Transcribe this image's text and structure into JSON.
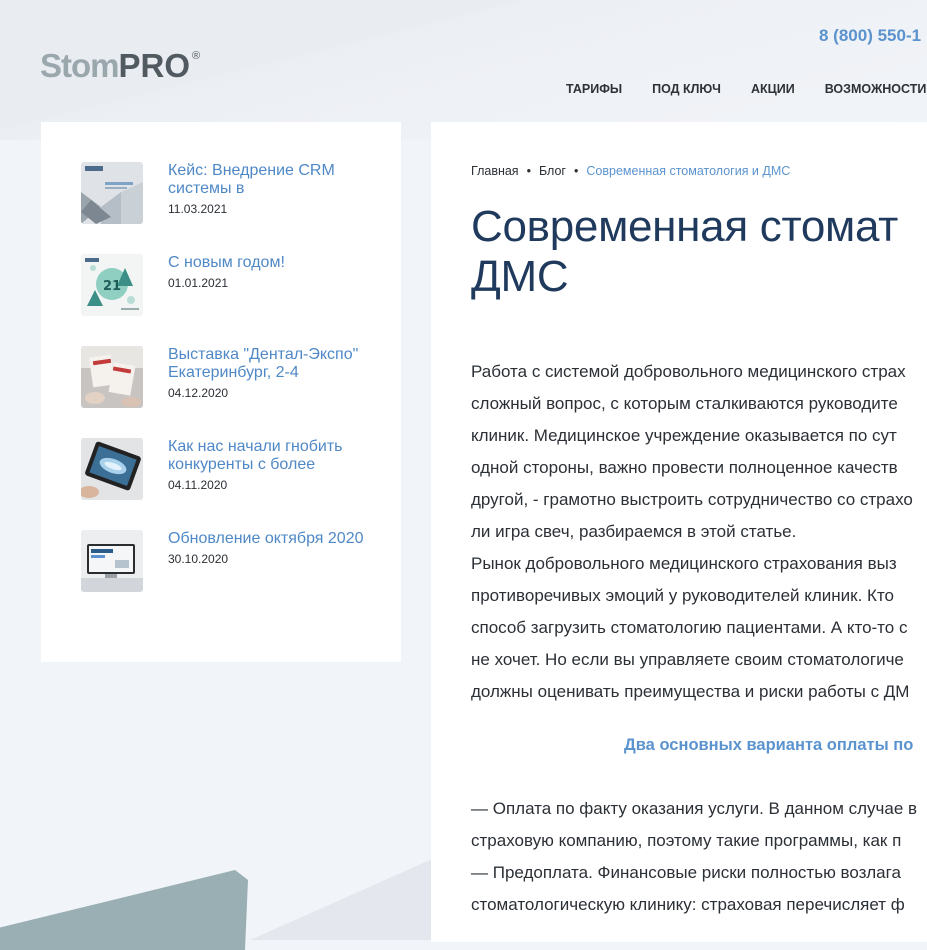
{
  "header": {
    "logo_stom": "Stom",
    "logo_pro": "PRO",
    "logo_reg": "®",
    "phone": "8 (800) 550-1",
    "nav": [
      "ТАРИФЫ",
      "ПОД КЛЮЧ",
      "АКЦИИ",
      "ВОЗМОЖНОСТИ"
    ]
  },
  "sidebar": {
    "posts": [
      {
        "title": "Кейс: Внедрение CRM системы в",
        "date": "11.03.2021",
        "thumb": "crm-case-thumbnail"
      },
      {
        "title": "С новым годом!",
        "date": "01.01.2021",
        "thumb": "new-year-2021-thumbnail"
      },
      {
        "title": "Выставка \"Дентал-Экспо\" Екатеринбург, 2-4",
        "date": "04.12.2020",
        "thumb": "dental-expo-thumbnail"
      },
      {
        "title": "Как нас начали гнобить конкуренты с более",
        "date": "04.11.2020",
        "thumb": "xray-tablet-thumbnail"
      },
      {
        "title": "Обновление октября 2020",
        "date": "30.10.2020",
        "thumb": "october-update-thumbnail"
      }
    ]
  },
  "breadcrumb": {
    "home": "Главная",
    "blog": "Блог",
    "current": "Современная стоматология и ДМС",
    "separator": "•"
  },
  "article": {
    "title_line1": "Современная стомат",
    "title_line2": "ДМС",
    "paragraph_lines": [
      "Работа с системой добровольного медицинского страх",
      "сложный вопрос, с которым сталкиваются руководите",
      "клиник. Медицинское учреждение оказывается по сут",
      "одной стороны, важно провести полноценное качеств",
      "другой, - грамотно выстроить сотрудничество со страхо",
      "ли игра свеч, разбираемся в этой статье.",
      "Рынок добровольного медицинского страхования выз",
      "противоречивых эмоций у руководителей клиник. Кто",
      "способ загрузить стоматологию пациентами. А кто-то с",
      "не хочет. Но если вы управляете своим стоматологиче",
      "должны оценивать преимущества и риски работы с ДМ"
    ],
    "subheading": "Два основных варианта оплаты по",
    "paragraph2_lines": [
      "— Оплата по факту оказания услуги. В данном случае в",
      "страховую компанию, поэтому такие программы, как п",
      "— Предоплата. Финансовые риски полностью возлага",
      "стоматологическую клинику: страховая перечисляет ф"
    ]
  }
}
